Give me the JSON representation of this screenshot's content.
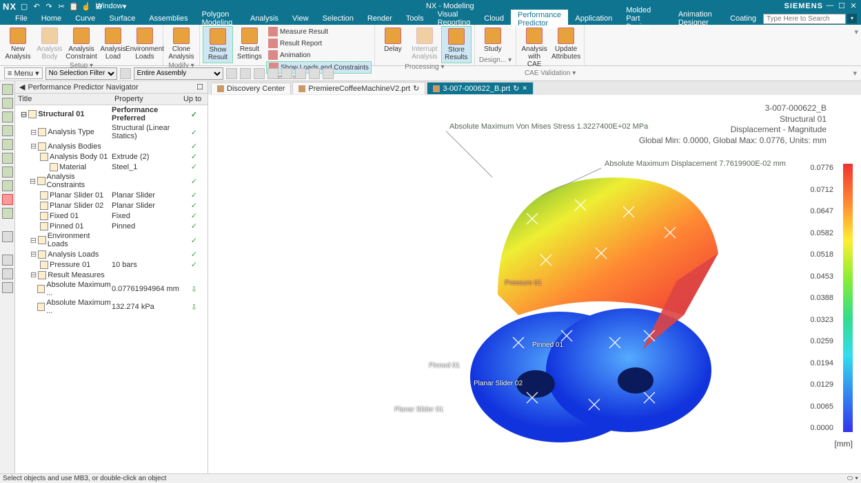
{
  "app": {
    "title": "NX - Modeling",
    "brand": "SIEMENS",
    "logo": "NX",
    "window_dropdown": "Window"
  },
  "menu": {
    "items": [
      "File",
      "Home",
      "Curve",
      "Surface",
      "Assemblies",
      "Polygon Modeling",
      "Analysis",
      "View",
      "Selection",
      "Render",
      "Tools",
      "Visual Reporting",
      "Cloud",
      "Performance Predictor",
      "Application",
      "Molded Part Design",
      "Animation Designer",
      "Coating"
    ],
    "active_index": 13,
    "search_placeholder": "Type Here to Search"
  },
  "ribbon": {
    "groups": [
      {
        "label": "Setup",
        "buttons": [
          {
            "label": "New Analysis",
            "disabled": false
          },
          {
            "label": "Analysis Body",
            "disabled": true
          },
          {
            "label": "Analysis Constraint",
            "disabled": false
          },
          {
            "label": "Analysis Load",
            "disabled": false
          },
          {
            "label": "Environment Loads",
            "disabled": false
          }
        ]
      },
      {
        "label": "Modify",
        "buttons": [
          {
            "label": "Clone Analysis",
            "disabled": false
          }
        ]
      },
      {
        "label": "Results",
        "buttons": [
          {
            "label": "Show Result",
            "highlighted": true
          },
          {
            "label": "Result Settings"
          }
        ],
        "small": [
          {
            "label": "Measure Result"
          },
          {
            "label": "Result Report"
          },
          {
            "label": "Animation"
          },
          {
            "label": "Show Loads and Constraints",
            "highlighted": true
          }
        ]
      },
      {
        "label": "Processing",
        "buttons": [
          {
            "label": "Delay"
          },
          {
            "label": "Interrupt Analysis",
            "disabled": true
          },
          {
            "label": "Store Results",
            "highlighted": true
          }
        ]
      },
      {
        "label": "Design...",
        "buttons": [
          {
            "label": "Study"
          }
        ]
      },
      {
        "label": "CAE Validation",
        "buttons": [
          {
            "label": "Analysis with CAE"
          },
          {
            "label": "Update Attributes"
          }
        ]
      }
    ]
  },
  "toolbar2": {
    "menu_label": "Menu",
    "filter": "No Selection Filter",
    "assembly": "Entire Assembly"
  },
  "navigator": {
    "title": "Performance Predictor Navigator",
    "columns": [
      "Title",
      "Property",
      "Up to"
    ],
    "rows": [
      {
        "indent": 0,
        "title": "Structural 01",
        "prop": "Performance Preferred",
        "check": "✓",
        "bold": true
      },
      {
        "indent": 1,
        "title": "Analysis Type",
        "prop": "Structural (Linear Statics)",
        "check": "✓"
      },
      {
        "indent": 1,
        "title": "Analysis Bodies",
        "prop": "",
        "check": "✓"
      },
      {
        "indent": 2,
        "title": "Analysis Body 01",
        "prop": "Extrude (2)",
        "check": "✓"
      },
      {
        "indent": 3,
        "title": "Material",
        "prop": "Steel_1",
        "check": "✓"
      },
      {
        "indent": 1,
        "title": "Analysis Constraints",
        "prop": "",
        "check": "✓"
      },
      {
        "indent": 2,
        "title": "Planar Slider 01",
        "prop": "Planar Slider",
        "check": "✓"
      },
      {
        "indent": 2,
        "title": "Planar Slider 02",
        "prop": "Planar Slider",
        "check": "✓"
      },
      {
        "indent": 2,
        "title": "Fixed 01",
        "prop": "Fixed",
        "check": "✓"
      },
      {
        "indent": 2,
        "title": "Pinned 01",
        "prop": "Pinned",
        "check": "✓"
      },
      {
        "indent": 1,
        "title": "Environment Loads",
        "prop": "",
        "check": "✓"
      },
      {
        "indent": 1,
        "title": "Analysis Loads",
        "prop": "",
        "check": "✓"
      },
      {
        "indent": 2,
        "title": "Pressure 01",
        "prop": "10 bars",
        "check": "✓"
      },
      {
        "indent": 1,
        "title": "Result Measures",
        "prop": "",
        "check": ""
      },
      {
        "indent": 2,
        "title": "Absolute Maximum ...",
        "prop": "0.07761994964 mm",
        "check": "⇩"
      },
      {
        "indent": 2,
        "title": "Absolute Maximum ...",
        "prop": "132.274 kPa",
        "check": "⇩"
      }
    ]
  },
  "tabs": {
    "items": [
      {
        "label": "Discovery Center",
        "active": false,
        "closable": false
      },
      {
        "label": "PremiereCoffeeMachineV2.prt",
        "active": false,
        "closable": true
      },
      {
        "label": "3-007-000622_B.prt",
        "active": true,
        "closable": true
      }
    ]
  },
  "result_info": {
    "part": "3-007-000622_B",
    "analysis": "Structural 01",
    "measure": "Displacement - Magnitude",
    "range": "Global Min: 0.0000, Global Max: 0.0776, Units: mm"
  },
  "annotations": {
    "stress": "Absolute Maximum Von Mises Stress 1.3227400E+02 MPa",
    "displacement": "Absolute Maximum Displacement 7.7619900E-02 mm"
  },
  "part_labels": {
    "pinned01": "Pinned 01",
    "pinned02": "Pinned 01",
    "slider01": "Planar Slider 01",
    "slider02": "Planar Slider 02",
    "pressure": "Pressure 01"
  },
  "legend": {
    "values": [
      "0.0776",
      "0.0712",
      "0.0647",
      "0.0582",
      "0.0518",
      "0.0453",
      "0.0388",
      "0.0323",
      "0.0259",
      "0.0194",
      "0.0129",
      "0.0065",
      "0.0000"
    ],
    "unit": "[mm]"
  },
  "statusbar": {
    "text": "Select objects and use MB3, or double-click an object"
  }
}
